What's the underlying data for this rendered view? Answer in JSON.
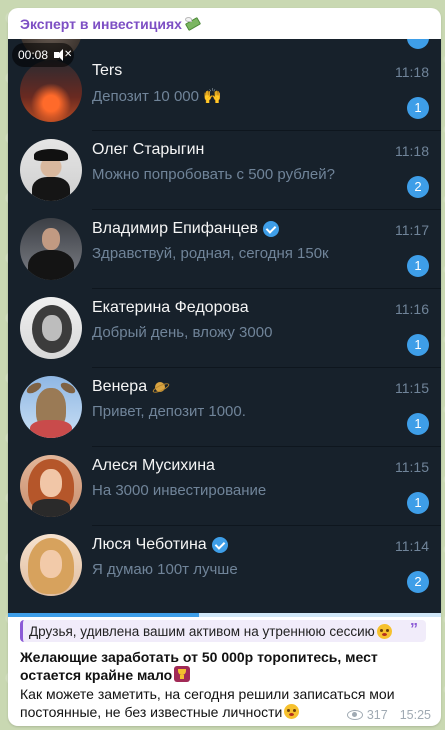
{
  "post": {
    "channel_name": "Эксперт в инвестициях",
    "video": {
      "elapsed": "00:08",
      "progress": 0.44
    },
    "chats": [
      {
        "name": "Ters",
        "preview": "Депозит 10 000 🙌",
        "time": "11:18",
        "unread": "1",
        "verified": false
      },
      {
        "name": "Олег Старыгин",
        "preview": "Можно попробовать с 500 рублей?",
        "time": "11:18",
        "unread": "2",
        "verified": false
      },
      {
        "name": "Владимир Епифанцев",
        "preview": "Здравствуй, родная, сегодня 150к",
        "time": "11:17",
        "unread": "1",
        "verified": true
      },
      {
        "name": "Екатерина Федорова",
        "preview": "Добрый день, вложу 3000",
        "time": "11:16",
        "unread": "1",
        "verified": false
      },
      {
        "name": "Венера",
        "preview": "Привет, депозит 1000.",
        "time": "11:15",
        "unread": "1",
        "verified": false
      },
      {
        "name": "Алеся Мусихина",
        "preview": "На 3000 инвестирование",
        "time": "11:15",
        "unread": "1",
        "verified": false
      },
      {
        "name": "Люся Чеботина",
        "preview": "Я думаю 100т лучше",
        "time": "11:14",
        "unread": "2",
        "verified": true
      }
    ],
    "reply_quote": "Друзья, удивлена вашим активом на утреннюю сессию",
    "bold_text": "Желающие заработать от 50 000р торопитесь, мест остается крайне мало",
    "body_text": "Как можете заметить, на сегодня решили записаться мои постоянные, не без известные личности",
    "views": "317",
    "time": "15:25"
  },
  "colors": {
    "accent": "#3e9ee8",
    "channel_name": "#7d4fc4",
    "dark_bg": "#17212b",
    "muted_text": "#708499"
  },
  "icons": [
    "money-with-wings-icon",
    "mute-icon",
    "verified-icon",
    "saturn-icon",
    "quote-icon",
    "grinning-face-icon",
    "trophy-icon",
    "eye-icon"
  ]
}
